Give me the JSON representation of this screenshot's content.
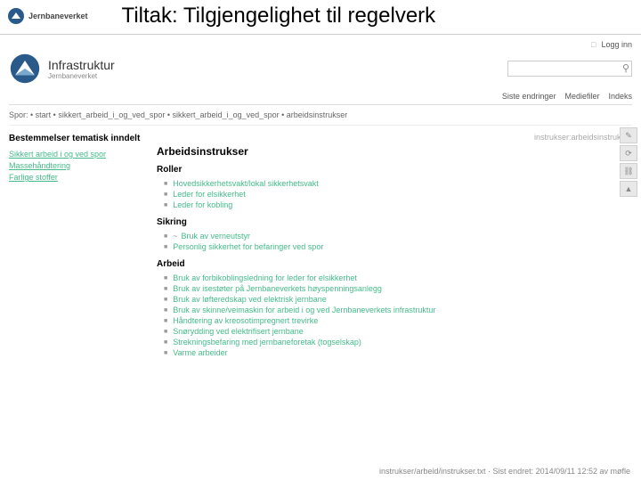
{
  "slide_title": "Tiltak: Tilgjengelighet til regelverk",
  "brand_small": "Jernbaneverket",
  "topbar": {
    "login": "Logg inn"
  },
  "header": {
    "title": "Infrastruktur",
    "subtitle": "Jernbaneverket"
  },
  "subnav": {
    "recent": "Siste endringer",
    "media": "Mediefiler",
    "index": "Indeks"
  },
  "breadcrumbs": "Spor: • start • sikkert_arbeid_i_og_ved_spor • sikkert_arbeid_i_og_ved_spor • arbeidsinstrukser",
  "bc_right": "instrukser:arbeidsinstrukser",
  "sidebar": {
    "title": "Bestemmelser tematisk inndelt",
    "items": [
      "Sikkert arbeid i og ved spor",
      "Massehåndtering",
      "Farlige stoffer"
    ]
  },
  "main": {
    "heading": "Arbeidsinstrukser",
    "sections": [
      {
        "title": "Roller",
        "items": [
          {
            "t": "Hovedsikkerhetsvakt/lokal sikkerhetsvakt"
          },
          {
            "t": "Leder for elsikkerhet"
          },
          {
            "t": "Leder for kobling"
          }
        ]
      },
      {
        "title": "Sikring",
        "items": [
          {
            "p": "~",
            "t": "Bruk av verneutstyr"
          },
          {
            "t": "Personlig sikkerhet for befaringer ved spor"
          }
        ]
      },
      {
        "title": "Arbeid",
        "items": [
          {
            "t": "Bruk av forbikoblingsledning for leder for elsikkerhet"
          },
          {
            "t": "Bruk av isestøter på Jernbaneverkets høyspenningsanlegg"
          },
          {
            "t": "Bruk av løfteredskap ved elektrisk jernbane"
          },
          {
            "t": "Bruk av skinne/veimaskin for arbeid i og ved Jernbaneverkets infrastruktur"
          },
          {
            "t": "Håndtering av kreosotimpregnert trevirke"
          },
          {
            "t": "Snørydding ved elektrifisert jernbane"
          },
          {
            "t": "Strekningsbefaring med jernbaneforetak (togselskap)"
          },
          {
            "t": "Varme arbeider"
          }
        ]
      }
    ]
  },
  "footer": "instrukser/arbeid/instrukser.txt · Sist endret: 2014/09/11 12:52 av møfle"
}
